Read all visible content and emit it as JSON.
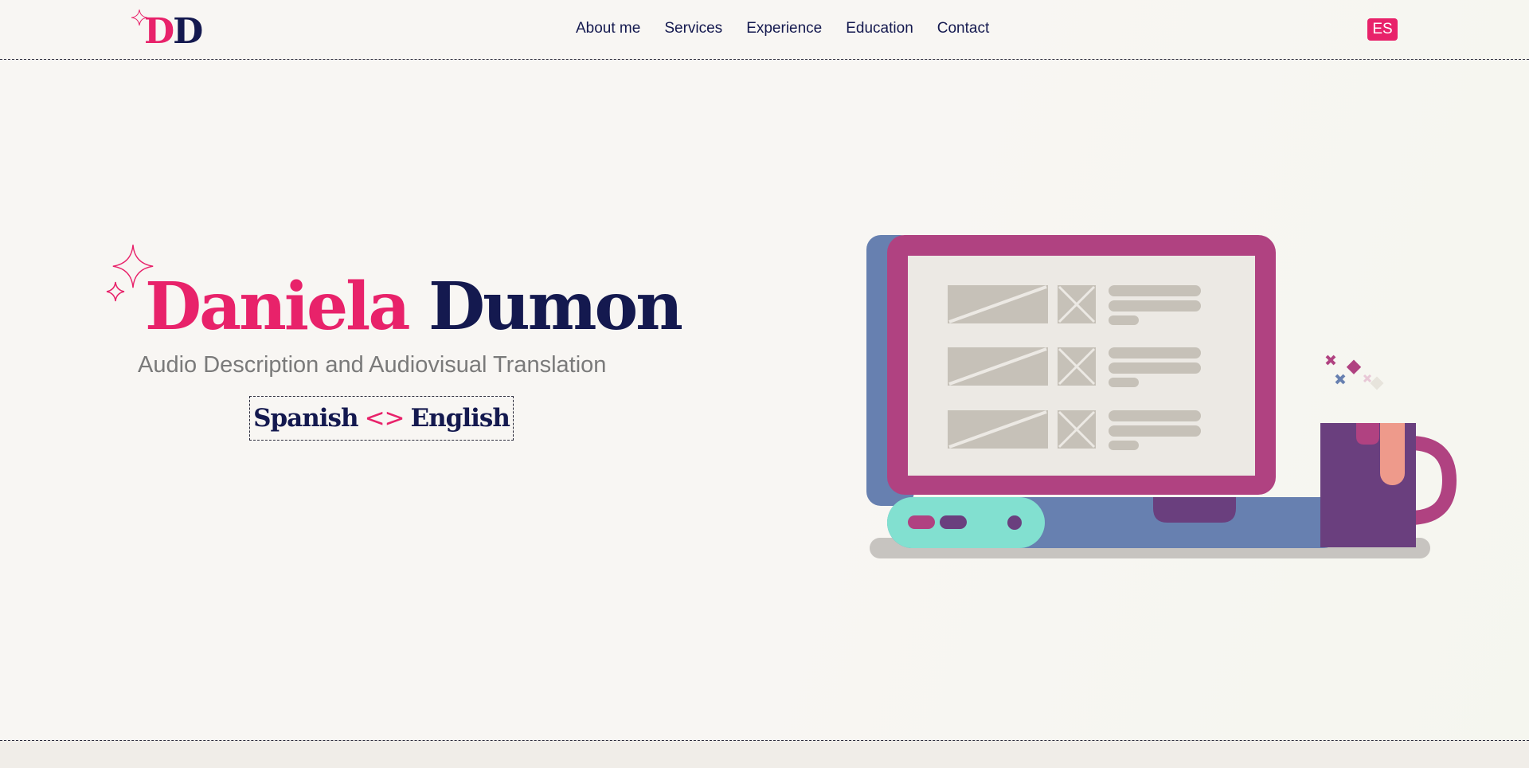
{
  "header": {
    "logo": {
      "letter1": "D",
      "letter2": "D"
    },
    "nav": [
      {
        "label": "About me"
      },
      {
        "label": "Services"
      },
      {
        "label": "Experience"
      },
      {
        "label": "Education"
      },
      {
        "label": "Contact"
      }
    ],
    "language_button": "ES"
  },
  "hero": {
    "first_name": "Daniela",
    "last_name": "Dumon",
    "subtitle": "Audio Description and Audiovisual Translation",
    "language_pair": {
      "from": "Spanish",
      "separator": "<>",
      "to": "English"
    }
  },
  "colors": {
    "accent": "#e8226a",
    "navy": "#14194f",
    "subtitle_gray": "#7a7a7a",
    "monitor_magenta": "#b04281",
    "monitor_blue": "#6780b0",
    "keyboard_mint": "#82e0d0",
    "mug_purple": "#6a3f7e",
    "background": "#f8f6f3"
  },
  "icons": [
    "sparkle-icon",
    "laptop-illustration",
    "mug-illustration"
  ]
}
